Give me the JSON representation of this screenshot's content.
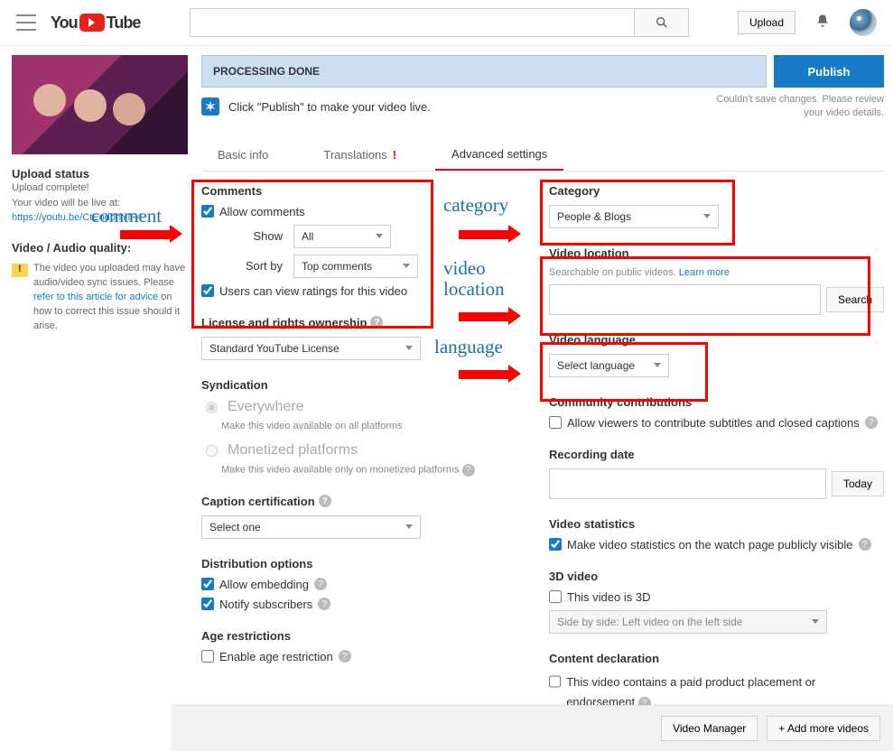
{
  "header": {
    "logo_prefix": "You",
    "logo_suffix": "Tube",
    "search_placeholder": "",
    "upload_label": "Upload"
  },
  "sidebar": {
    "status_title": "Upload status",
    "status_line1": "Upload complete!",
    "status_line2": "Your video will be live at:",
    "video_url": "https://youtu.be/CtEodbhYIF4",
    "quality_title": "Video / Audio quality:",
    "quality_text_1": "The video you uploaded may have audio/video sync issues. Please ",
    "quality_link": "refer to this article for advice",
    "quality_text_2": " on how to correct this issue should it arise."
  },
  "processing": {
    "status": "PROCESSING DONE",
    "publish_btn": "Publish",
    "publish_hint": "Click \"Publish\" to make your video live.",
    "save_error_1": "Couldn't save changes. Please review",
    "save_error_2": "your video details."
  },
  "tabs": {
    "basic": "Basic info",
    "translations": "Translations",
    "advanced": "Advanced settings"
  },
  "comments": {
    "title": "Comments",
    "allow": "Allow comments",
    "show_label": "Show",
    "show_value": "All",
    "sort_label": "Sort by",
    "sort_value": "Top comments",
    "ratings": "Users can view ratings for this video"
  },
  "license": {
    "title": "License and rights ownership",
    "value": "Standard YouTube License"
  },
  "syndication": {
    "title": "Syndication",
    "opt1": "Everywhere",
    "opt1_hint": "Make this video available on all platforms",
    "opt2": "Monetized platforms",
    "opt2_hint": "Make this video available only on monetized platforms"
  },
  "caption": {
    "title": "Caption certification",
    "value": "Select one"
  },
  "distribution": {
    "title": "Distribution options",
    "embedding": "Allow embedding",
    "notify": "Notify subscribers"
  },
  "age": {
    "title": "Age restrictions",
    "enable": "Enable age restriction"
  },
  "category": {
    "title": "Category",
    "value": "People & Blogs"
  },
  "location": {
    "title": "Video location",
    "hint": "Searchable on public videos. ",
    "learn": "Learn more",
    "search_btn": "Search"
  },
  "language": {
    "title": "Video language",
    "value": "Select language"
  },
  "community": {
    "title": "Community contributions",
    "allow": "Allow viewers to contribute subtitles and closed captions"
  },
  "recording": {
    "title": "Recording date",
    "today": "Today"
  },
  "stats": {
    "title": "Video statistics",
    "visible": "Make video statistics on the watch page publicly visible"
  },
  "three_d": {
    "title": "3D video",
    "is3d": "This video is 3D",
    "mode": "Side by side: Left video on the left side"
  },
  "declaration": {
    "title": "Content declaration",
    "paid": "This video contains a paid product placement or endorsement"
  },
  "footer": {
    "manager": "Video Manager",
    "add_more": "+  Add more videos"
  },
  "annotations": {
    "comment": "comment",
    "category": "category",
    "location": "video location",
    "language": "language"
  }
}
